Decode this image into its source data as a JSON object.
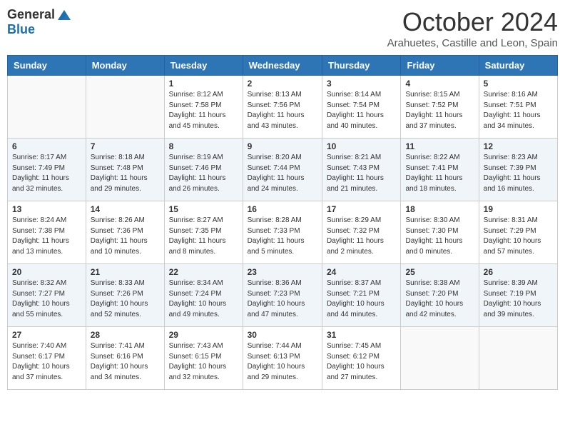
{
  "header": {
    "logo_general": "General",
    "logo_blue": "Blue",
    "month_title": "October 2024",
    "location": "Arahuetes, Castille and Leon, Spain"
  },
  "weekdays": [
    "Sunday",
    "Monday",
    "Tuesday",
    "Wednesday",
    "Thursday",
    "Friday",
    "Saturday"
  ],
  "weeks": [
    [
      {
        "day": "",
        "info": ""
      },
      {
        "day": "",
        "info": ""
      },
      {
        "day": "1",
        "info": "Sunrise: 8:12 AM\nSunset: 7:58 PM\nDaylight: 11 hours and 45 minutes."
      },
      {
        "day": "2",
        "info": "Sunrise: 8:13 AM\nSunset: 7:56 PM\nDaylight: 11 hours and 43 minutes."
      },
      {
        "day": "3",
        "info": "Sunrise: 8:14 AM\nSunset: 7:54 PM\nDaylight: 11 hours and 40 minutes."
      },
      {
        "day": "4",
        "info": "Sunrise: 8:15 AM\nSunset: 7:52 PM\nDaylight: 11 hours and 37 minutes."
      },
      {
        "day": "5",
        "info": "Sunrise: 8:16 AM\nSunset: 7:51 PM\nDaylight: 11 hours and 34 minutes."
      }
    ],
    [
      {
        "day": "6",
        "info": "Sunrise: 8:17 AM\nSunset: 7:49 PM\nDaylight: 11 hours and 32 minutes."
      },
      {
        "day": "7",
        "info": "Sunrise: 8:18 AM\nSunset: 7:48 PM\nDaylight: 11 hours and 29 minutes."
      },
      {
        "day": "8",
        "info": "Sunrise: 8:19 AM\nSunset: 7:46 PM\nDaylight: 11 hours and 26 minutes."
      },
      {
        "day": "9",
        "info": "Sunrise: 8:20 AM\nSunset: 7:44 PM\nDaylight: 11 hours and 24 minutes."
      },
      {
        "day": "10",
        "info": "Sunrise: 8:21 AM\nSunset: 7:43 PM\nDaylight: 11 hours and 21 minutes."
      },
      {
        "day": "11",
        "info": "Sunrise: 8:22 AM\nSunset: 7:41 PM\nDaylight: 11 hours and 18 minutes."
      },
      {
        "day": "12",
        "info": "Sunrise: 8:23 AM\nSunset: 7:39 PM\nDaylight: 11 hours and 16 minutes."
      }
    ],
    [
      {
        "day": "13",
        "info": "Sunrise: 8:24 AM\nSunset: 7:38 PM\nDaylight: 11 hours and 13 minutes."
      },
      {
        "day": "14",
        "info": "Sunrise: 8:26 AM\nSunset: 7:36 PM\nDaylight: 11 hours and 10 minutes."
      },
      {
        "day": "15",
        "info": "Sunrise: 8:27 AM\nSunset: 7:35 PM\nDaylight: 11 hours and 8 minutes."
      },
      {
        "day": "16",
        "info": "Sunrise: 8:28 AM\nSunset: 7:33 PM\nDaylight: 11 hours and 5 minutes."
      },
      {
        "day": "17",
        "info": "Sunrise: 8:29 AM\nSunset: 7:32 PM\nDaylight: 11 hours and 2 minutes."
      },
      {
        "day": "18",
        "info": "Sunrise: 8:30 AM\nSunset: 7:30 PM\nDaylight: 11 hours and 0 minutes."
      },
      {
        "day": "19",
        "info": "Sunrise: 8:31 AM\nSunset: 7:29 PM\nDaylight: 10 hours and 57 minutes."
      }
    ],
    [
      {
        "day": "20",
        "info": "Sunrise: 8:32 AM\nSunset: 7:27 PM\nDaylight: 10 hours and 55 minutes."
      },
      {
        "day": "21",
        "info": "Sunrise: 8:33 AM\nSunset: 7:26 PM\nDaylight: 10 hours and 52 minutes."
      },
      {
        "day": "22",
        "info": "Sunrise: 8:34 AM\nSunset: 7:24 PM\nDaylight: 10 hours and 49 minutes."
      },
      {
        "day": "23",
        "info": "Sunrise: 8:36 AM\nSunset: 7:23 PM\nDaylight: 10 hours and 47 minutes."
      },
      {
        "day": "24",
        "info": "Sunrise: 8:37 AM\nSunset: 7:21 PM\nDaylight: 10 hours and 44 minutes."
      },
      {
        "day": "25",
        "info": "Sunrise: 8:38 AM\nSunset: 7:20 PM\nDaylight: 10 hours and 42 minutes."
      },
      {
        "day": "26",
        "info": "Sunrise: 8:39 AM\nSunset: 7:19 PM\nDaylight: 10 hours and 39 minutes."
      }
    ],
    [
      {
        "day": "27",
        "info": "Sunrise: 7:40 AM\nSunset: 6:17 PM\nDaylight: 10 hours and 37 minutes."
      },
      {
        "day": "28",
        "info": "Sunrise: 7:41 AM\nSunset: 6:16 PM\nDaylight: 10 hours and 34 minutes."
      },
      {
        "day": "29",
        "info": "Sunrise: 7:43 AM\nSunset: 6:15 PM\nDaylight: 10 hours and 32 minutes."
      },
      {
        "day": "30",
        "info": "Sunrise: 7:44 AM\nSunset: 6:13 PM\nDaylight: 10 hours and 29 minutes."
      },
      {
        "day": "31",
        "info": "Sunrise: 7:45 AM\nSunset: 6:12 PM\nDaylight: 10 hours and 27 minutes."
      },
      {
        "day": "",
        "info": ""
      },
      {
        "day": "",
        "info": ""
      }
    ]
  ]
}
